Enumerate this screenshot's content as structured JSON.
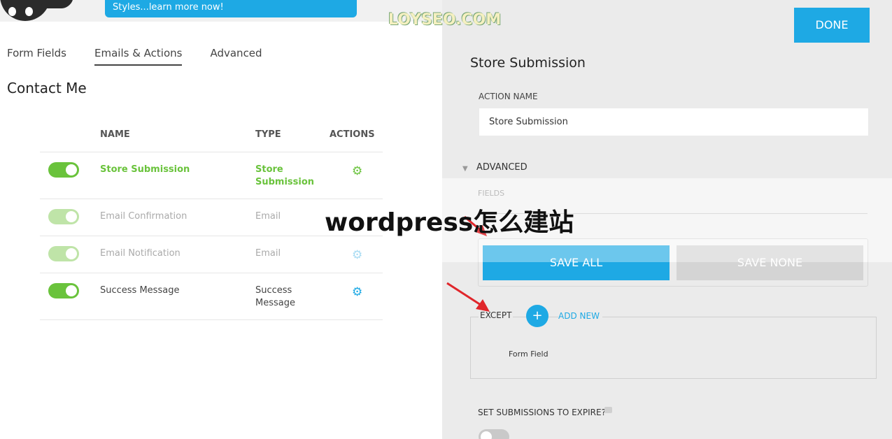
{
  "promo": {
    "text": "Styles...learn more now!"
  },
  "tabs": [
    {
      "label": "Form Fields"
    },
    {
      "label": "Emails & Actions"
    },
    {
      "label": "Advanced"
    }
  ],
  "form": {
    "title": "Contact Me"
  },
  "table": {
    "headers": {
      "name": "NAME",
      "type": "TYPE",
      "actions": "ACTIONS"
    },
    "rows": [
      {
        "name": "Store Submission",
        "type": "Store Submission",
        "enabled": true
      },
      {
        "name": "Email Confirmation",
        "type": "Email",
        "enabled": true
      },
      {
        "name": "Email Notification",
        "type": "Email",
        "enabled": true
      },
      {
        "name": "Success Message",
        "type": "Success Message",
        "enabled": true
      }
    ]
  },
  "watermark": "LOYSEO.COM",
  "caption": "wordpress怎么建站",
  "panel": {
    "done_label": "DONE",
    "title": "Store Submission",
    "action_name_label": "ACTION NAME",
    "action_name_value": "Store Submission",
    "advanced_label": "ADVANCED",
    "fields_label": "FIELDS",
    "save_all_label": "SAVE ALL",
    "save_none_label": "SAVE NONE",
    "except_label": "EXCEPT",
    "add_new_label": "ADD NEW",
    "add_icon": "+",
    "form_field_label": "Form Field",
    "expire_label": "SET SUBMISSIONS TO EXPIRE?",
    "expire_enabled": false
  },
  "colors": {
    "accent": "#1ea9e4",
    "toggle_on": "#6ac33c",
    "annotation": "#e0262b"
  }
}
